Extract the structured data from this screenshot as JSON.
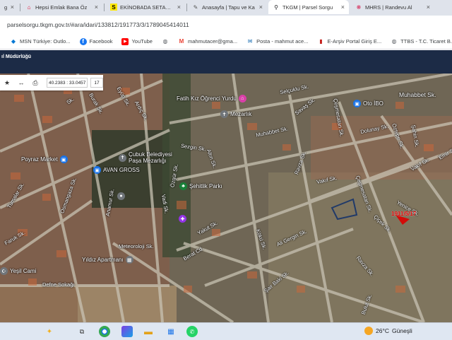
{
  "tabs": [
    {
      "title": "gis",
      "favicon": "globe-icon",
      "active": false
    },
    {
      "title": "Hepsi Emlak Bana Öz",
      "favicon": "hepsiemlak-icon",
      "active": false
    },
    {
      "title": "EKİNOBADA SETAKEN",
      "favicon": "sahibinden-icon",
      "active": false
    },
    {
      "title": "Anasayfa | Tapu ve Ka",
      "favicon": "tkgm-icon",
      "active": false
    },
    {
      "title": "TKGM | Parsel Sorgu",
      "favicon": "map-pin-icon",
      "active": true
    },
    {
      "title": "MHRS | Randevu Al",
      "favicon": "mhrs-icon",
      "active": false
    }
  ],
  "tab_close": "×",
  "address": {
    "url": "parselsorgu.tkgm.gov.tr/#ara/idari/133812/191773/3/1789045414011"
  },
  "bookmarks": [
    {
      "label": "MSN Türkiye: Outlo...",
      "icon": "msn-icon",
      "color": "#0078d4",
      "glyph": "◆"
    },
    {
      "label": "Facebook",
      "icon": "facebook-icon",
      "color": "#1877f2",
      "glyph": "f"
    },
    {
      "label": "YouTube",
      "icon": "youtube-icon",
      "color": "#ff0000",
      "glyph": "▶"
    },
    {
      "label": "",
      "icon": "globe-icon",
      "color": "#5f6368",
      "glyph": "◍"
    },
    {
      "label": "mahmutacer@gma...",
      "icon": "gmail-icon",
      "color": "#ea4335",
      "glyph": "M"
    },
    {
      "label": "Posta - mahmut ace...",
      "icon": "outlook-icon",
      "color": "#0a64ad",
      "glyph": "✉"
    },
    {
      "label": "E-Arşiv Portal Giriş E...",
      "icon": "earsiv-icon",
      "color": "#c5221f",
      "glyph": "▮"
    },
    {
      "label": "TTBS - T.C. Ticaret B...",
      "icon": "globe-icon",
      "color": "#5f6368",
      "glyph": "◍"
    }
  ],
  "site": {
    "title": "ıl Müdürlüğü"
  },
  "map_tools": {
    "coords": "40.2383 : 33.0457",
    "zoom": "17",
    "star_icon": "star-icon",
    "measure_icon": "measure-icon",
    "print_icon": "print-icon"
  },
  "street_labels": [
    "Sk.",
    "Burak Sk.",
    "Eyüp Sk.",
    "Ardıç Sk.",
    "Fatih Kız Öğrenci Yurdu",
    "Selçuklu Sk.",
    "Muhabbet Sk.",
    "Savaş Sk.",
    "Çeşmesatan Sk.",
    "Oto İBO",
    "Dolunay Sk.",
    "Muhabbet Sk.",
    "Öztepe Sk.",
    "Şahin Sk.",
    "Sezgin Sk.",
    "Altın Sk.",
    "Poyraz Market",
    "Çubuk Belediyesi Paşa Mezarlığı",
    "AVAN GROSS",
    "Tumalar Sk.",
    "Osmangaza Sk.",
    "Şehitlik Parkı",
    "Özgür Sk.",
    "Vakıf Sk.",
    "Ravza Sk.",
    "Çeşmesatan Sk.",
    "Vakıf Sk.",
    "Yenice Sk.",
    "Anamur Sk.",
    "Vadi Sk.",
    "Yakut Sk.",
    "Çiçek Sk.",
    "Ali Gergin Sk.",
    "Kökü Sk.",
    "Faruk Sk.",
    "Meteoroloji Sk.",
    "Berat Cd.",
    "Yıldız Apartmanı",
    "Yeşil Cami",
    "Defne Sokağı",
    "Şair Baki Sk.",
    "Ravza Sk.",
    "Bulut Sk.",
    "Mezarlık",
    "Emir Sk."
  ],
  "parcel": {
    "label": "1911/5/17"
  },
  "taskbar": {
    "weather_temp": "26°C",
    "weather_desc": "Güneşli",
    "search_glyph": "✦",
    "search_icon": "search-icon"
  }
}
